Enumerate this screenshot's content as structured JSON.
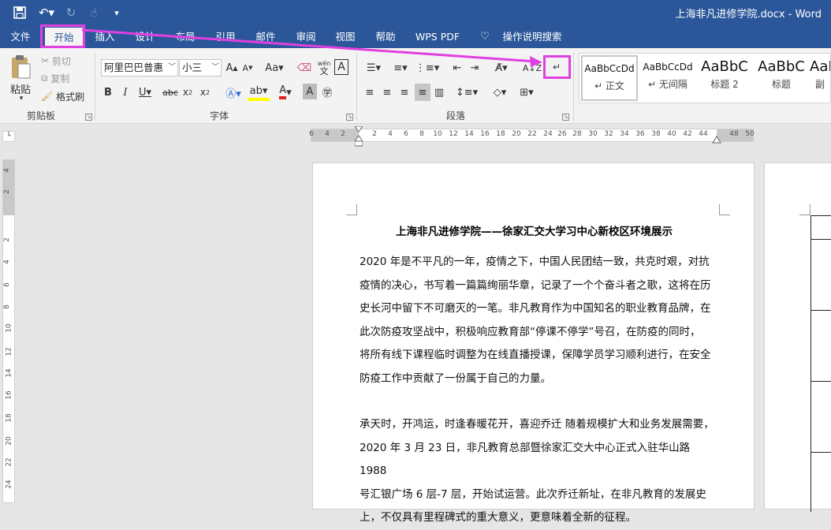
{
  "window": {
    "title": "上海非凡进修学院.docx - Word"
  },
  "quick_access": {
    "save_icon": "save-icon",
    "undo_icon": "undo-icon",
    "redo_icon": "redo-icon",
    "touch_icon": "touch-mode-icon",
    "customize_icon": "customize-icon"
  },
  "tabs": [
    {
      "label": "文件"
    },
    {
      "label": "开始"
    },
    {
      "label": "插入"
    },
    {
      "label": "设计"
    },
    {
      "label": "布局"
    },
    {
      "label": "引用"
    },
    {
      "label": "邮件"
    },
    {
      "label": "审阅"
    },
    {
      "label": "视图"
    },
    {
      "label": "帮助"
    },
    {
      "label": "WPS PDF"
    },
    {
      "label": "操作说明搜索"
    }
  ],
  "clipboard": {
    "paste": "粘贴",
    "cut": "剪切",
    "copy": "复制",
    "format_painter": "格式刷",
    "label": "剪贴板"
  },
  "font": {
    "name": "阿里巴巴普惠",
    "size": "小三",
    "label": "字体",
    "phonetic_top": "wén",
    "phonetic_bottom": "文"
  },
  "paragraph": {
    "label": "段落"
  },
  "styles": [
    {
      "sample": "AaBbCcDd",
      "name": "↵ 正文"
    },
    {
      "sample": "AaBbCcDd",
      "name": "↵ 无间隔"
    },
    {
      "sample": "AaBbC",
      "name": "标题 2"
    },
    {
      "sample": "AaBbC",
      "name": "标题"
    },
    {
      "sample": "AaBbC",
      "name": "副"
    }
  ],
  "ruler": {
    "marks": [
      "6",
      "4",
      "2",
      "2",
      "4",
      "6",
      "8",
      "10",
      "12",
      "14",
      "16",
      "18",
      "20",
      "22",
      "24",
      "26",
      "28",
      "30",
      "32",
      "34",
      "36",
      "38",
      "40",
      "42",
      "44",
      "48",
      "50"
    ],
    "vmarks": [
      "4",
      "2",
      "2",
      "4",
      "6",
      "8",
      "10",
      "12",
      "14",
      "16",
      "18",
      "20",
      "22",
      "24"
    ]
  },
  "document": {
    "title": "上海非凡进修学院——徐家汇交大学习中心新校区环境展示",
    "lines1": [
      "2020 年是不平凡的一年，疫情之下，中国人民团结一致，共克时艰，对抗",
      "疫情的决心，书写着一篇篇绚丽华章，记录了一个个奋斗者之歌，这将在历",
      "史长河中留下不可磨灭的一笔。非凡教育作为中国知名的职业教育品牌，在",
      "此次防疫攻坚战中，积极响应教育部“停课不停学”号召，在防疫的同时，",
      "将所有线下课程临时调整为在线直播授课，保障学员学习顺利进行，在安全",
      "防疫工作中贡献了一份属于自己的力量。"
    ],
    "lines2": [
      "承天时，开鸿运，时逢春暖花开，喜迎乔迁  随着规模扩大和业务发展需要，",
      "2020 年 3 月 23 日，非凡教育总部暨徐家汇交大中心正式入驻华山路 1988",
      "号汇银广场 6 层-7 层，开始试运营。此次乔迁新址，在非凡教育的发展史",
      "上，不仅具有里程碑式的重大意义，更意味着全新的征程。"
    ]
  },
  "colors": {
    "brand": "#2b579a",
    "highlight": "#e040e0"
  }
}
